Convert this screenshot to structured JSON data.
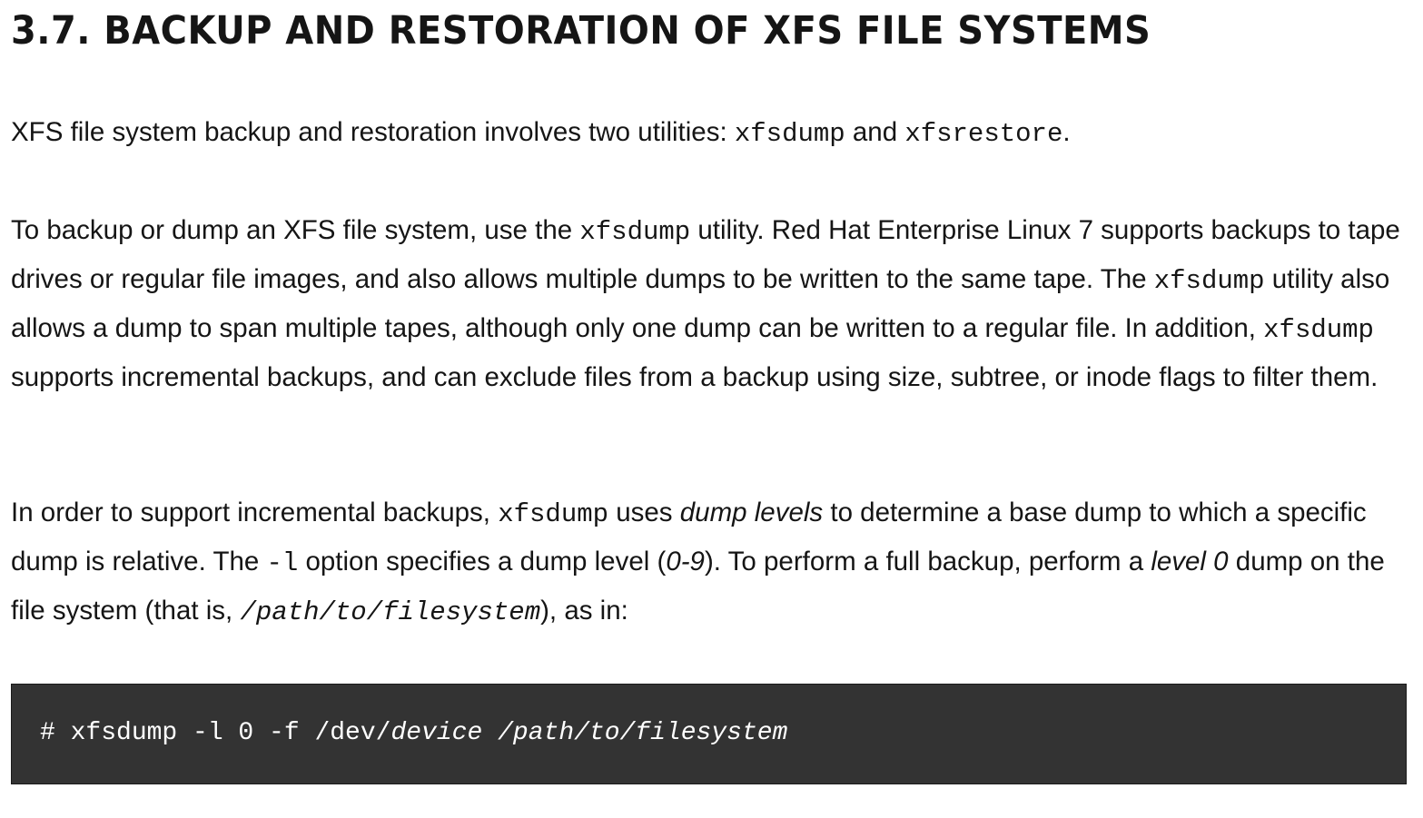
{
  "heading": "3.7. BACKUP AND RESTORATION OF XFS FILE SYSTEMS",
  "p1": {
    "t1": "XFS file system backup and restoration involves two utilities: ",
    "c1": "xfsdump",
    "t2": " and ",
    "c2": "xfsrestore",
    "t3": "."
  },
  "p2": {
    "t1": "To backup or dump an XFS file system, use the ",
    "c1": "xfsdump",
    "t2": " utility. Red Hat Enterprise Linux 7 supports backups to tape drives or regular file images, and also allows multiple dumps to be written to the same tape. The ",
    "c2": "xfsdump",
    "t3": " utility also allows a dump to span multiple tapes, although only one dump can be written to a regular file. In addition, ",
    "c3": "xfsdump",
    "t4": " supports incremental backups, and can exclude files from a backup using size, subtree, or inode flags to filter them."
  },
  "p3": {
    "t1": "In order to support incremental backups, ",
    "c1": "xfsdump",
    "t2": " uses ",
    "e1": "dump levels",
    "t3": " to determine a base dump to which a specific dump is relative. The ",
    "c2": "-l",
    "t4": " option specifies a dump level (",
    "e2": "0-9",
    "t5": "). To perform a full backup, perform a ",
    "e3": "level 0",
    "t6": " dump on the file system (that is, ",
    "ci1": "/path/to/filesystem",
    "t7": "), as in:"
  },
  "code": {
    "prefix": "# xfsdump -l 0 -f /dev/",
    "arg1": "device",
    "space": " ",
    "arg2": "/path/to/filesystem"
  }
}
